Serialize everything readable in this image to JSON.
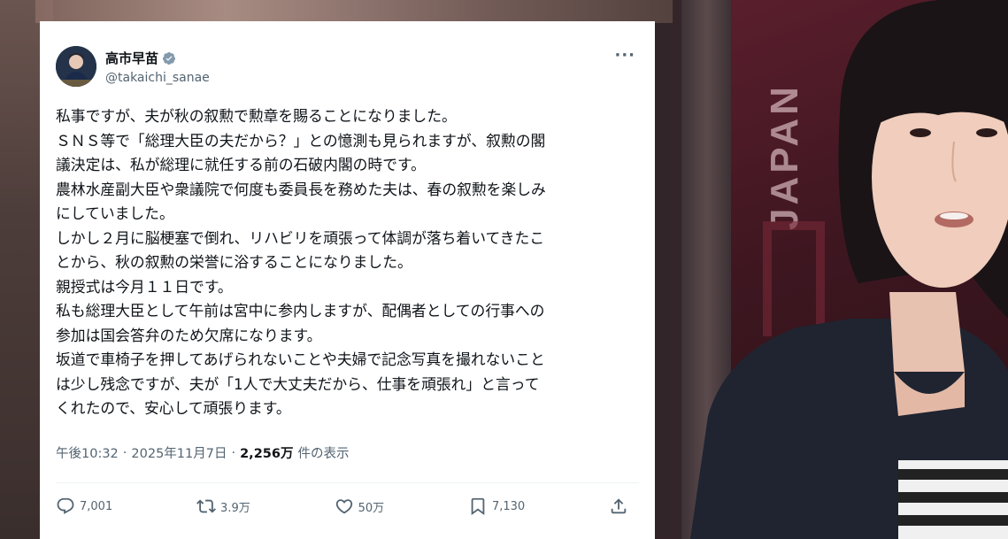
{
  "background": {
    "overlay_text": "JAPAN"
  },
  "tweet": {
    "author_name": "高市早苗",
    "handle": "@takaichi_sanae",
    "more_icon": "ellipsis-icon",
    "body_lines": [
      "私事ですが、夫が秋の叙勲で勲章を賜ることになりました。",
      "ＳＮＳ等で「総理大臣の夫だから？」との憶測も見られますが、叙勲の閣",
      "議決定は、私が総理に就任する前の石破内閣の時です。",
      "農林水産副大臣や衆議院で何度も委員長を務めた夫は、春の叙勲を楽しみ",
      "にしていました。",
      "しかし２月に脳梗塞で倒れ、リハビリを頑張って体調が落ち着いてきたこ",
      "とから、秋の叙勲の栄誉に浴することになりました。",
      "親授式は今月１１日です。",
      "私も総理大臣として午前は宮中に参内しますが、配偶者としての行事への",
      "参加は国会答弁のため欠席になります。",
      "坂道で車椅子を押してあげられないことや夫婦で記念写真を撮れないこと",
      "は少し残念ですが、夫が「1人で大丈夫だから、仕事を頑張れ」と言って",
      "くれたので、安心して頑張ります。"
    ],
    "time": "午後10:32",
    "sep1": "·",
    "date": "2025年11月7日",
    "sep2": "·",
    "views_count": "2,256万",
    "views_label": "件の表示",
    "actions": {
      "replies": "7,001",
      "reposts": "3.9万",
      "likes": "50万",
      "bookmarks": "7,130"
    }
  },
  "colors": {
    "text_primary": "#0f1419",
    "text_secondary": "#536471",
    "verified": "#829aab"
  }
}
